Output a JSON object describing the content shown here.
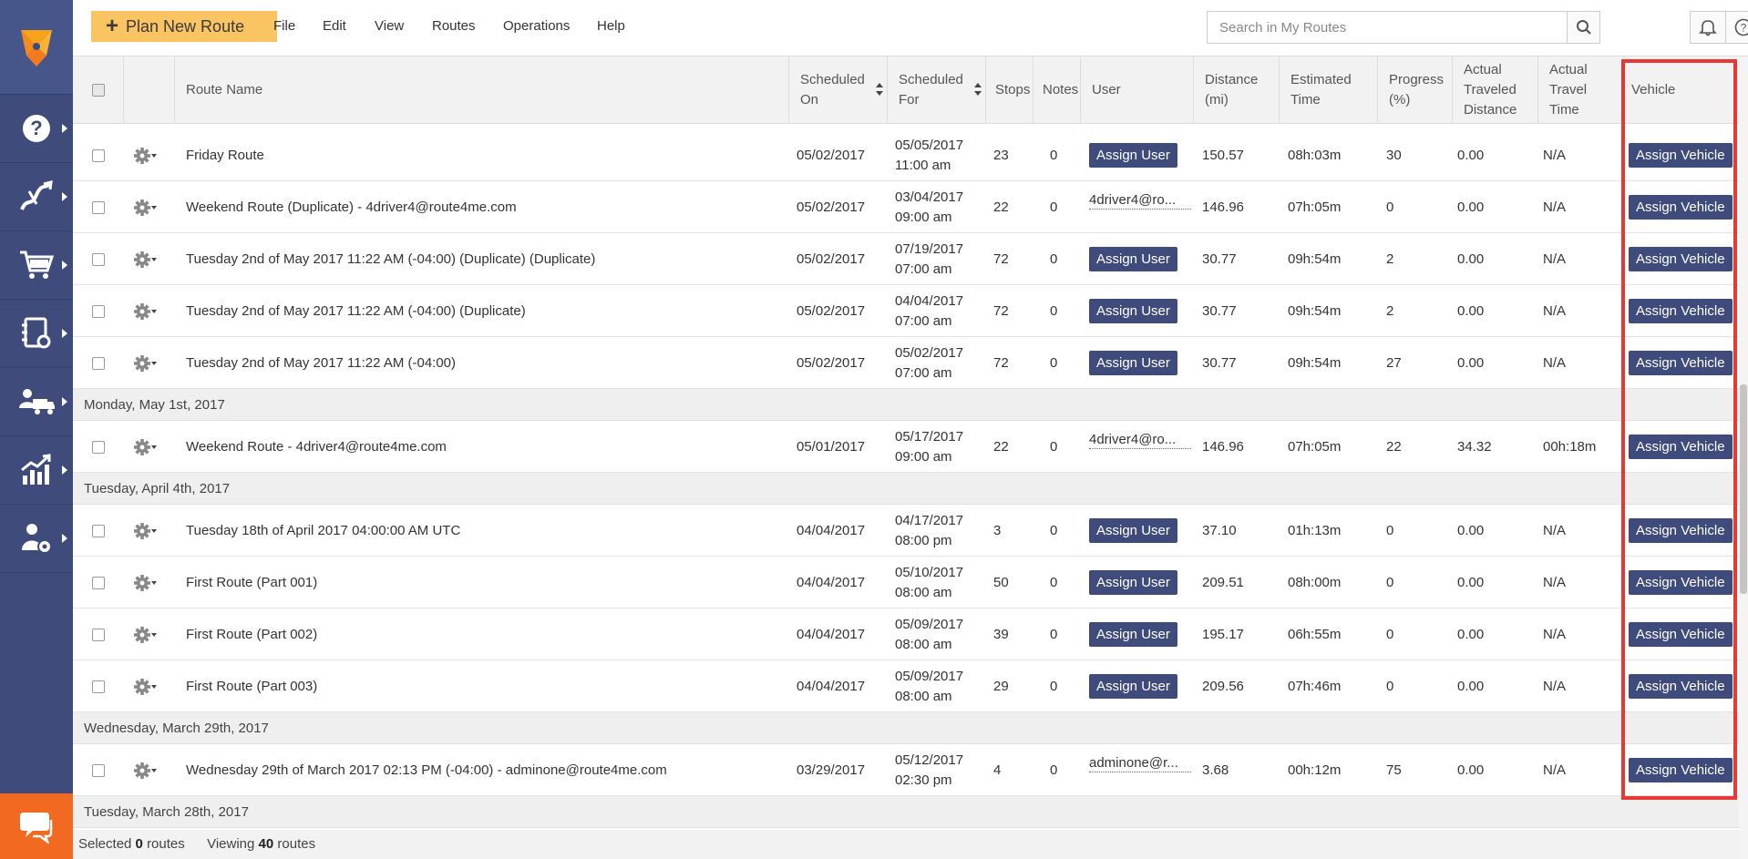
{
  "toolbar": {
    "plan_button": "Plan New Route",
    "menu": [
      "File",
      "Edit",
      "View",
      "Routes",
      "Operations",
      "Help"
    ],
    "search_placeholder": "Search in My Routes"
  },
  "sidebar": {
    "items": [
      "help-icon",
      "routes-icon",
      "cart-icon",
      "address-book-icon",
      "fleet-icon",
      "analytics-icon",
      "user-settings-icon"
    ],
    "chat": "chat-icon"
  },
  "columns": {
    "route_name": "Route Name",
    "scheduled_on": "Scheduled\nOn",
    "scheduled_for": "Scheduled\nFor",
    "stops": "Stops",
    "notes": "Notes",
    "user": "User",
    "distance": "Distance\n(mi)",
    "estimated_time": "Estimated\nTime",
    "progress": "Progress\n(%)",
    "actual_distance": "Actual\nTraveled\nDistance",
    "actual_time": "Actual\nTravel\nTime",
    "vehicle": "Vehicle"
  },
  "rows": [
    {
      "type": "route",
      "name": "Friday Route",
      "on": "05/02/2017",
      "for_date": "05/05/2017",
      "for_time": "11:00 am",
      "stops": "23",
      "notes": "0",
      "user": "",
      "distance": "150.57",
      "est": "08h:03m",
      "progress": "30",
      "act_dist": "0.00",
      "act_time": "N/A"
    },
    {
      "type": "route",
      "name": "Weekend Route (Duplicate) - 4driver4@route4me.com",
      "on": "05/02/2017",
      "for_date": "03/04/2017",
      "for_time": "09:00 am",
      "stops": "22",
      "notes": "0",
      "user": "4driver4@ro...",
      "distance": "146.96",
      "est": "07h:05m",
      "progress": "0",
      "act_dist": "0.00",
      "act_time": "N/A"
    },
    {
      "type": "route",
      "name": "Tuesday 2nd of May 2017 11:22 AM (-04:00) (Duplicate) (Duplicate)",
      "on": "05/02/2017",
      "for_date": "07/19/2017",
      "for_time": "07:00 am",
      "stops": "72",
      "notes": "0",
      "user": "",
      "distance": "30.77",
      "est": "09h:54m",
      "progress": "2",
      "act_dist": "0.00",
      "act_time": "N/A"
    },
    {
      "type": "route",
      "name": "Tuesday 2nd of May 2017 11:22 AM (-04:00) (Duplicate)",
      "on": "05/02/2017",
      "for_date": "04/04/2017",
      "for_time": "07:00 am",
      "stops": "72",
      "notes": "0",
      "user": "",
      "distance": "30.77",
      "est": "09h:54m",
      "progress": "2",
      "act_dist": "0.00",
      "act_time": "N/A"
    },
    {
      "type": "route",
      "name": "Tuesday 2nd of May 2017 11:22 AM (-04:00)",
      "on": "05/02/2017",
      "for_date": "05/02/2017",
      "for_time": "07:00 am",
      "stops": "72",
      "notes": "0",
      "user": "",
      "distance": "30.77",
      "est": "09h:54m",
      "progress": "27",
      "act_dist": "0.00",
      "act_time": "N/A"
    },
    {
      "type": "group",
      "label": "Monday, May 1st, 2017"
    },
    {
      "type": "route",
      "name": "Weekend Route - 4driver4@route4me.com",
      "on": "05/01/2017",
      "for_date": "05/17/2017",
      "for_time": "09:00 am",
      "stops": "22",
      "notes": "0",
      "user": "4driver4@ro...",
      "distance": "146.96",
      "est": "07h:05m",
      "progress": "22",
      "act_dist": "34.32",
      "act_time": "00h:18m"
    },
    {
      "type": "group",
      "label": "Tuesday, April 4th, 2017"
    },
    {
      "type": "route",
      "name": "Tuesday 18th of April 2017 04:00:00 AM UTC",
      "on": "04/04/2017",
      "for_date": "04/17/2017",
      "for_time": "08:00 pm",
      "stops": "3",
      "notes": "0",
      "user": "",
      "distance": "37.10",
      "est": "01h:13m",
      "progress": "0",
      "act_dist": "0.00",
      "act_time": "N/A"
    },
    {
      "type": "route",
      "name": "First Route (Part 001)",
      "on": "04/04/2017",
      "for_date": "05/10/2017",
      "for_time": "08:00 am",
      "stops": "50",
      "notes": "0",
      "user": "",
      "distance": "209.51",
      "est": "08h:00m",
      "progress": "0",
      "act_dist": "0.00",
      "act_time": "N/A"
    },
    {
      "type": "route",
      "name": "First Route (Part 002)",
      "on": "04/04/2017",
      "for_date": "05/09/2017",
      "for_time": "08:00 am",
      "stops": "39",
      "notes": "0",
      "user": "",
      "distance": "195.17",
      "est": "06h:55m",
      "progress": "0",
      "act_dist": "0.00",
      "act_time": "N/A"
    },
    {
      "type": "route",
      "name": "First Route (Part 003)",
      "on": "04/04/2017",
      "for_date": "05/09/2017",
      "for_time": "08:00 am",
      "stops": "29",
      "notes": "0",
      "user": "",
      "distance": "209.56",
      "est": "07h:46m",
      "progress": "0",
      "act_dist": "0.00",
      "act_time": "N/A"
    },
    {
      "type": "group",
      "label": "Wednesday, March 29th, 2017"
    },
    {
      "type": "route",
      "name": "Wednesday 29th of March 2017 02:13 PM (-04:00) - adminone@route4me.com",
      "on": "03/29/2017",
      "for_date": "05/12/2017",
      "for_time": "02:30 pm",
      "stops": "4",
      "notes": "0",
      "user": "adminone@r...",
      "distance": "3.68",
      "est": "00h:12m",
      "progress": "75",
      "act_dist": "0.00",
      "act_time": "N/A"
    },
    {
      "type": "group",
      "label": "Tuesday, March 28th, 2017"
    }
  ],
  "buttons": {
    "assign_user": "Assign User",
    "assign_vehicle": "Assign Vehicle"
  },
  "footer": {
    "selected_prefix": "Selected",
    "selected_count": "0",
    "selected_suffix": "routes",
    "viewing_prefix": "Viewing",
    "viewing_count": "40",
    "viewing_suffix": "routes"
  },
  "colors": {
    "sidebar": "#3f4c7b",
    "accent": "#fbc463",
    "chat": "#f26a21",
    "highlight": "#e53935"
  }
}
